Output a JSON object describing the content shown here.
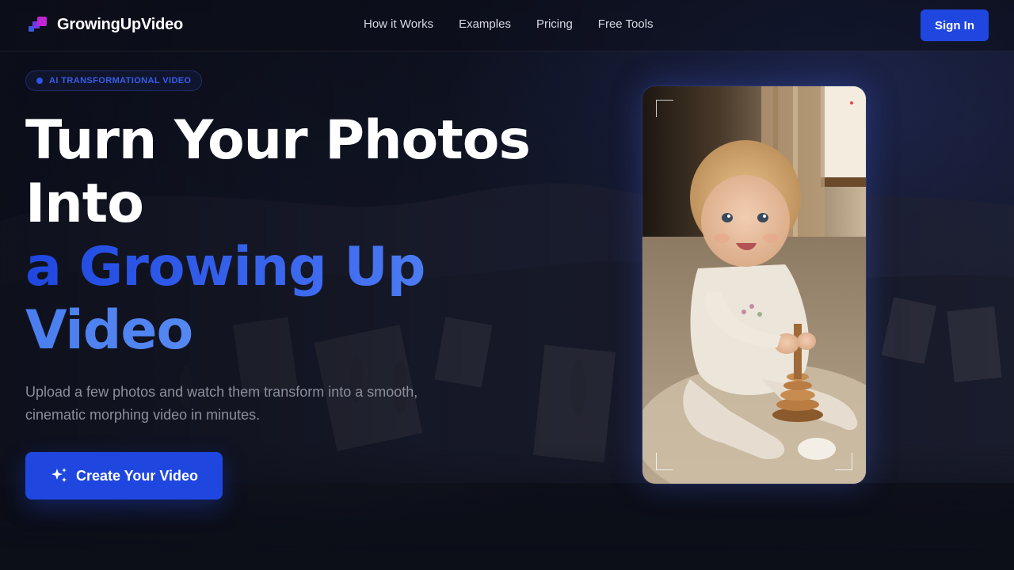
{
  "nav": {
    "brand": "GrowingUpVideo",
    "links": [
      "How it Works",
      "Examples",
      "Pricing",
      "Free Tools"
    ],
    "signin_label": "Sign In"
  },
  "hero": {
    "badge": "AI TRANSFORMATIONAL VIDEO",
    "headline": {
      "line1": "Turn Your Photos",
      "line2": "Into",
      "line3": "a Growing Up",
      "line4": "Video"
    },
    "subtitle": "Upload a few photos and watch them transform into a smooth, cinematic morphing video in minutes.",
    "cta_label": "Create Your Video"
  },
  "colors": {
    "accent": "#1f47e0",
    "background": "#0e1220",
    "gradient_end": "#6a9bf7",
    "muted_text": "#8c8f9c"
  },
  "icons": [
    "logo-mark-icon",
    "sparkles-icon",
    "record-dot-icon"
  ]
}
